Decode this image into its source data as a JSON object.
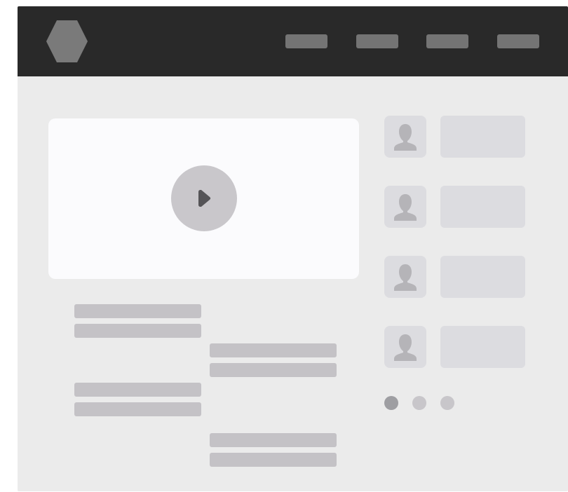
{
  "topbar": {
    "logo_icon": "hexagon-logo-icon",
    "nav_items": [
      "nav-placeholder",
      "nav-placeholder",
      "nav-placeholder",
      "nav-placeholder"
    ],
    "background": "#292929"
  },
  "main": {
    "video": {
      "play_icon": "play-icon"
    },
    "text_blocks": 4
  },
  "sidebar": {
    "users": [
      {
        "avatar_icon": "user-silhouette-icon"
      },
      {
        "avatar_icon": "user-silhouette-icon"
      },
      {
        "avatar_icon": "user-silhouette-icon"
      },
      {
        "avatar_icon": "user-silhouette-icon"
      }
    ],
    "pagination": {
      "total": 3,
      "active": 1
    }
  },
  "colors": {
    "page_background": "#ebebeb",
    "video_background": "#fbfbfd",
    "placeholder": "#c4c2c6",
    "active_dot": "#9e9ea2"
  }
}
